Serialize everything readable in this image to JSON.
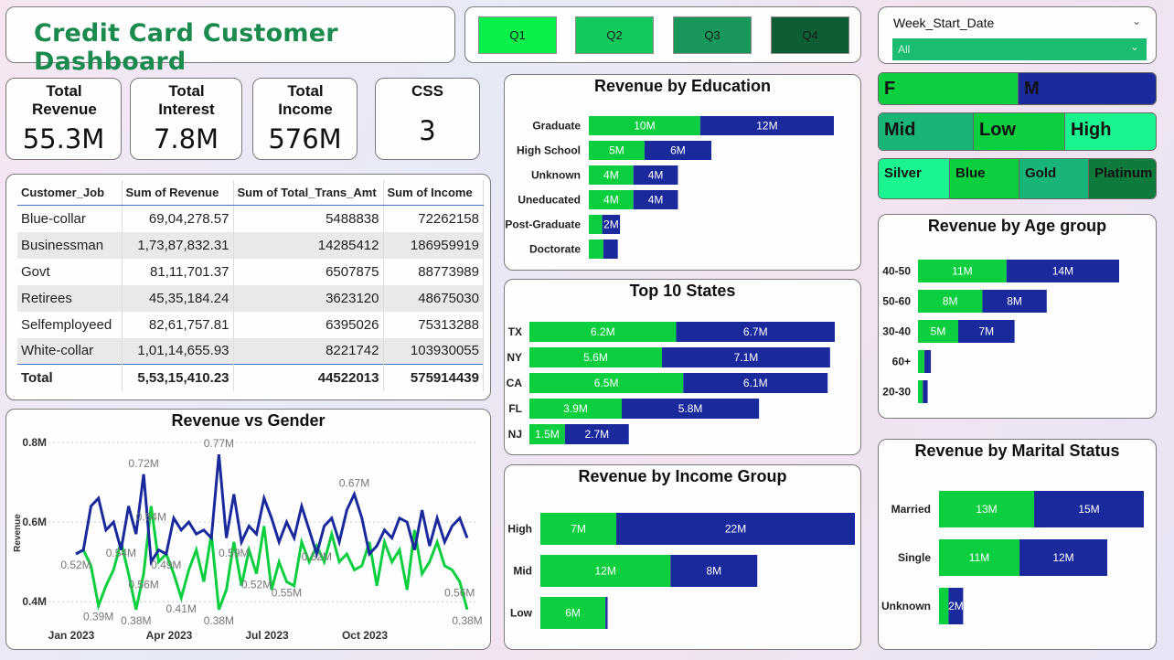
{
  "title": "Credit Card Customer Dashboard",
  "quarters": [
    "Q1",
    "Q2",
    "Q3",
    "Q4"
  ],
  "kpis": [
    {
      "label": "Total Revenue",
      "value": "55.3M"
    },
    {
      "label": "Total Interest",
      "value": "7.8M"
    },
    {
      "label": "Total Income",
      "value": "576M"
    },
    {
      "label": "CSS",
      "value": "3"
    }
  ],
  "table": {
    "headers": [
      "Customer_Job",
      "Sum of Revenue",
      "Sum of Total_Trans_Amt",
      "Sum of Income"
    ],
    "rows": [
      [
        "Blue-collar",
        "69,04,278.57",
        "5488838",
        "72262158"
      ],
      [
        "Businessman",
        "1,73,87,832.31",
        "14285412",
        "186959919"
      ],
      [
        "Govt",
        "81,11,701.37",
        "6507875",
        "88773989"
      ],
      [
        "Retirees",
        "45,35,184.24",
        "3623120",
        "48675030"
      ],
      [
        "Selfemployeed",
        "82,61,757.81",
        "6395026",
        "75313288"
      ],
      [
        "White-collar",
        "1,01,14,655.93",
        "8221742",
        "103930055"
      ]
    ],
    "total": [
      "Total",
      "5,53,15,410.23",
      "44522013",
      "575914439"
    ]
  },
  "slicer": {
    "header": "Week_Start_Date",
    "value": "All"
  },
  "gender_slicer": [
    "F",
    "M"
  ],
  "income_slicer": [
    "Mid",
    "Low",
    "High"
  ],
  "card_slicer": [
    "Silver",
    "Blue",
    "Gold",
    "Platinum"
  ],
  "colors": {
    "female": "#0ccf3f",
    "male": "#1a2a9c"
  },
  "chart_data": [
    {
      "type": "bar",
      "title": "Revenue by Education",
      "categories": [
        "Graduate",
        "High School",
        "Unknown",
        "Uneducated",
        "Post-Graduate",
        "Doctorate"
      ],
      "series": [
        {
          "values": [
            10,
            5,
            4,
            4,
            1.2,
            1.3
          ],
          "labels": [
            "10M",
            "5M",
            "4M",
            "4M",
            "",
            ""
          ]
        },
        {
          "values": [
            12,
            6,
            4,
            4,
            1.6,
            1.3
          ],
          "labels": [
            "12M",
            "6M",
            "4M",
            "4M",
            "2M",
            ""
          ]
        }
      ]
    },
    {
      "type": "bar",
      "title": "Top 10 States",
      "categories": [
        "TX",
        "NY",
        "CA",
        "FL",
        "NJ"
      ],
      "series": [
        {
          "values": [
            6.2,
            5.6,
            6.5,
            3.9,
            1.5
          ],
          "labels": [
            "6.2M",
            "5.6M",
            "6.5M",
            "3.9M",
            "1.5M"
          ]
        },
        {
          "values": [
            6.7,
            7.1,
            6.1,
            5.8,
            2.7
          ],
          "labels": [
            "6.7M",
            "7.1M",
            "6.1M",
            "5.8M",
            "2.7M"
          ]
        }
      ]
    },
    {
      "type": "bar",
      "title": "Revenue by Income Group",
      "categories": [
        "High",
        "Mid",
        "Low"
      ],
      "series": [
        {
          "values": [
            7,
            12,
            6
          ],
          "labels": [
            "7M",
            "12M",
            "6M"
          ]
        },
        {
          "values": [
            22,
            8,
            0.2
          ],
          "labels": [
            "22M",
            "8M",
            ""
          ]
        }
      ]
    },
    {
      "type": "bar",
      "title": "Revenue by Age group",
      "categories": [
        "40-50",
        "50-60",
        "30-40",
        "60+",
        "20-30"
      ],
      "series": [
        {
          "values": [
            11,
            8,
            5,
            0.8,
            0.6
          ],
          "labels": [
            "11M",
            "8M",
            "5M",
            "",
            ""
          ]
        },
        {
          "values": [
            14,
            8,
            7,
            0.8,
            0.6
          ],
          "labels": [
            "14M",
            "8M",
            "7M",
            "",
            ""
          ]
        }
      ]
    },
    {
      "type": "bar",
      "title": "Revenue by Marital Status",
      "categories": [
        "Married",
        "Single",
        "Unknown"
      ],
      "series": [
        {
          "values": [
            13,
            11,
            1.3
          ],
          "labels": [
            "13M",
            "11M",
            ""
          ]
        },
        {
          "values": [
            15,
            12,
            2.0
          ],
          "labels": [
            "15M",
            "12M",
            "2M"
          ]
        }
      ]
    },
    {
      "type": "line",
      "title": "Revenue vs Gender",
      "ylabel": "Revenue",
      "y_ticks": [
        "0.4M",
        "0.6M",
        "0.8M"
      ],
      "ylim": [
        0.35,
        0.8
      ],
      "x_ticks": [
        "Jan 2023",
        "Apr 2023",
        "Jul 2023",
        "Oct 2023"
      ],
      "series": [
        {
          "values": [
            0.52,
            0.53,
            0.64,
            0.66,
            0.58,
            0.6,
            0.53,
            0.64,
            0.57,
            0.72,
            0.5,
            0.53,
            0.52,
            0.61,
            0.58,
            0.6,
            0.57,
            0.58,
            0.56,
            0.77,
            0.56,
            0.67,
            0.55,
            0.59,
            0.57,
            0.66,
            0.61,
            0.55,
            0.6,
            0.56,
            0.64,
            0.58,
            0.52,
            0.59,
            0.61,
            0.55,
            0.63,
            0.67,
            0.61,
            0.52,
            0.54,
            0.58,
            0.56,
            0.61,
            0.6,
            0.53,
            0.63,
            0.54,
            0.61,
            0.55,
            0.59,
            0.61,
            0.56
          ],
          "labels": {
            "9": "0.72M",
            "19": "0.77M",
            "37": "0.67M"
          }
        },
        {
          "values": [
            0.52,
            0.53,
            0.49,
            0.39,
            0.44,
            0.48,
            0.55,
            0.47,
            0.38,
            0.47,
            0.64,
            0.5,
            0.52,
            0.47,
            0.41,
            0.48,
            0.53,
            0.45,
            0.57,
            0.38,
            0.43,
            0.55,
            0.44,
            0.53,
            0.47,
            0.59,
            0.43,
            0.5,
            0.45,
            0.44,
            0.55,
            0.5,
            0.54,
            0.5,
            0.57,
            0.5,
            0.52,
            0.48,
            0.49,
            0.55,
            0.44,
            0.55,
            0.5,
            0.53,
            0.43,
            0.58,
            0.47,
            0.5,
            0.55,
            0.49,
            0.48,
            0.45,
            0.38
          ],
          "labels": {
            "0": "0.52M",
            "3": "0.39M",
            "6": "0.54M",
            "8": "0.38M",
            "9": "0.56M",
            "10": "0.64M",
            "12": "0.49M",
            "14": "0.41M",
            "19": "0.38M",
            "21": "0.59M",
            "24": "0.52M",
            "28": "0.55M",
            "32": "0.52M",
            "52": "0.38M",
            "51": "0.56M"
          }
        }
      ]
    }
  ]
}
